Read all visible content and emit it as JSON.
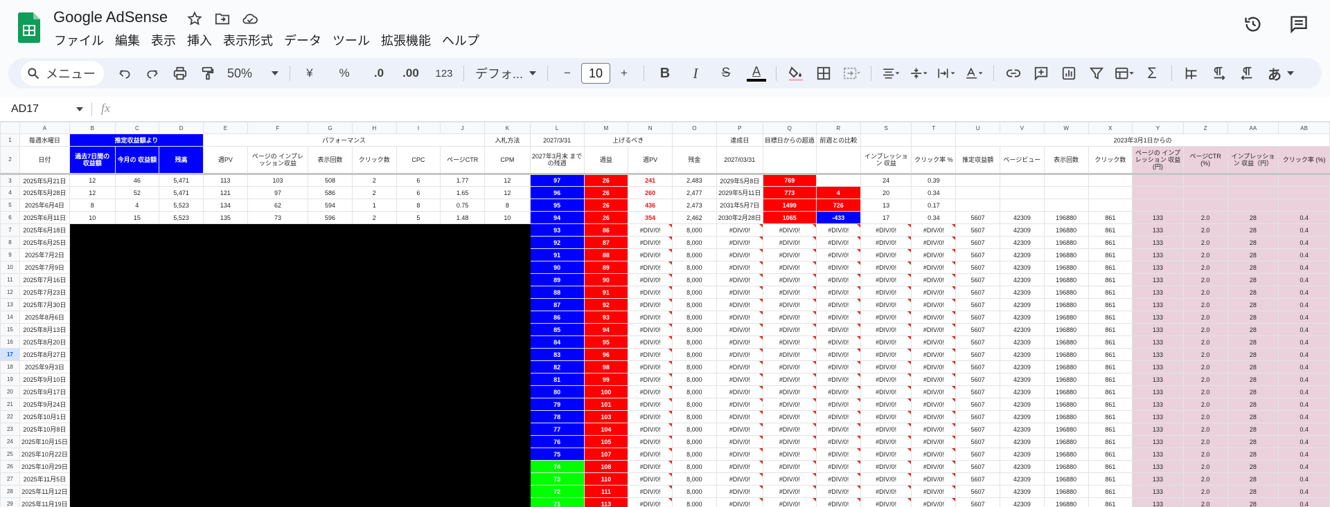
{
  "app": {
    "title": "Google AdSense",
    "menu": [
      "ファイル",
      "編集",
      "表示",
      "挿入",
      "表示形式",
      "データ",
      "ツール",
      "拡張機能",
      "ヘルプ"
    ]
  },
  "toolbar": {
    "search_label": "メニュー",
    "zoom": "50%",
    "currency": "¥",
    "percent": "%",
    "dec_decrease": ".0",
    "dec_increase": ".00",
    "number_format": "123",
    "font": "デフォ...",
    "font_size": "10",
    "minus": "−",
    "plus": "+",
    "bold": "B",
    "italic": "I",
    "strike": "S",
    "text_color": "A",
    "input_tools": "あ"
  },
  "formula_bar": {
    "name_box": "AD17",
    "fx": "fx"
  },
  "colors": {
    "blue": "#0000ff",
    "red": "#ff0000",
    "green": "#00ff00",
    "pink": "#ead1dc",
    "black": "#000000"
  },
  "grid": {
    "columns": [
      "A",
      "B",
      "C",
      "D",
      "E",
      "F",
      "G",
      "H",
      "I",
      "J",
      "K",
      "L",
      "M",
      "N",
      "O",
      "P",
      "Q",
      "R",
      "S",
      "T",
      "U",
      "V",
      "W",
      "X",
      "Y",
      "Z",
      "AA",
      "AB"
    ],
    "header_row1": {
      "A": "毎週水曜日",
      "BD": "推定収益額より",
      "EJ": "パフォーマンス",
      "K": "入札方法",
      "L": "2027/3/31",
      "MN": "上げるべき",
      "P": "達成日",
      "Q": "目標日からの超過",
      "R": "前週との比較",
      "UAB": "2023年3月1日からの"
    },
    "header_row2": [
      "日付",
      "過去7日間の 収益額",
      "今月の 収益額",
      "残高",
      "週PV",
      "ページの インプレッション収益",
      "表示回数",
      "クリック数",
      "CPC",
      "ページCTR",
      "CPM",
      "2027年3月末 までの残週",
      "週益",
      "週PV",
      "残金",
      "2027/03/31",
      "",
      "",
      "インプレッション 収益",
      "クリック率 %",
      "推定収益額",
      "ページビュー",
      "表示回数",
      "クリック数",
      "ページの インプレッション 収益(円)",
      "ページCTR (%)",
      "インプレッション 収益（円）",
      "クリック率 (%)"
    ],
    "top_rows": [
      {
        "num": "3",
        "A": "2025年5月21日",
        "B": "12",
        "C": "46",
        "D": "5,471",
        "E": "113",
        "F": "103",
        "G": "508",
        "H": "2",
        "I": "6",
        "J": "1.77",
        "K": "12",
        "L": "97",
        "M": "26",
        "N": "241",
        "O": "2,483",
        "P": "2029年5月8日",
        "Q": "769",
        "R": "",
        "S": "24",
        "T": "0.39"
      },
      {
        "num": "4",
        "A": "2025年5月28日",
        "B": "12",
        "C": "52",
        "D": "5,471",
        "E": "121",
        "F": "97",
        "G": "586",
        "H": "2",
        "I": "6",
        "J": "1.65",
        "K": "12",
        "L": "96",
        "M": "26",
        "N": "260",
        "O": "2,477",
        "P": "2029年5月11日",
        "Q": "773",
        "R": "4",
        "S": "20",
        "T": "0.34"
      },
      {
        "num": "5",
        "A": "2025年6月4日",
        "B": "8",
        "C": "4",
        "D": "5,523",
        "E": "134",
        "F": "62",
        "G": "594",
        "H": "1",
        "I": "8",
        "J": "0.75",
        "K": "8",
        "L": "95",
        "M": "26",
        "N": "436",
        "O": "2,473",
        "P": "2031年5月7日",
        "Q": "1499",
        "R": "726",
        "S": "13",
        "T": "0.17"
      },
      {
        "num": "6",
        "A": "2025年6月11日",
        "B": "10",
        "C": "15",
        "D": "5,523",
        "E": "135",
        "F": "73",
        "G": "596",
        "H": "2",
        "I": "5",
        "J": "1.48",
        "K": "10",
        "L": "94",
        "M": "26",
        "N": "354",
        "O": "2,462",
        "P": "2030年2月28日",
        "Q": "1065",
        "R": "-433",
        "S": "17",
        "T": "0.34",
        "U": "5607",
        "V": "42309",
        "W": "196880",
        "X": "861",
        "Y": "133",
        "Z": "2.0",
        "AA": "28",
        "AB": "0.4"
      }
    ],
    "lower_rows": [
      {
        "num": "7",
        "A": "2025年6月18日",
        "L": "93",
        "M": "86"
      },
      {
        "num": "8",
        "A": "2025年6月25日",
        "L": "92",
        "M": "87"
      },
      {
        "num": "9",
        "A": "2025年7月2日",
        "L": "91",
        "M": "88"
      },
      {
        "num": "10",
        "A": "2025年7月9日",
        "L": "90",
        "M": "89"
      },
      {
        "num": "11",
        "A": "2025年7月16日",
        "L": "89",
        "M": "90"
      },
      {
        "num": "12",
        "A": "2025年7月23日",
        "L": "88",
        "M": "91"
      },
      {
        "num": "13",
        "A": "2025年7月30日",
        "L": "87",
        "M": "92"
      },
      {
        "num": "14",
        "A": "2025年8月6日",
        "L": "86",
        "M": "93"
      },
      {
        "num": "15",
        "A": "2025年8月13日",
        "L": "85",
        "M": "94"
      },
      {
        "num": "16",
        "A": "2025年8月20日",
        "L": "84",
        "M": "95"
      },
      {
        "num": "17",
        "A": "2025年8月27日",
        "L": "83",
        "M": "96"
      },
      {
        "num": "18",
        "A": "2025年9月3日",
        "L": "82",
        "M": "98"
      },
      {
        "num": "19",
        "A": "2025年9月10日",
        "L": "81",
        "M": "99"
      },
      {
        "num": "20",
        "A": "2025年9月17日",
        "L": "80",
        "M": "100"
      },
      {
        "num": "21",
        "A": "2025年9月24日",
        "L": "79",
        "M": "101"
      },
      {
        "num": "22",
        "A": "2025年10月1日",
        "L": "78",
        "M": "103"
      },
      {
        "num": "23",
        "A": "2025年10月8日",
        "L": "77",
        "M": "104"
      },
      {
        "num": "24",
        "A": "2025年10月15日",
        "L": "76",
        "M": "105"
      },
      {
        "num": "25",
        "A": "2025年10月22日",
        "L": "75",
        "M": "107"
      },
      {
        "num": "26",
        "A": "2025年10月29日",
        "L": "74",
        "M": "108"
      },
      {
        "num": "27",
        "A": "2025年11月5日",
        "L": "73",
        "M": "110"
      },
      {
        "num": "28",
        "A": "2025年11月12日",
        "L": "72",
        "M": "111"
      },
      {
        "num": "29",
        "A": "2025年11月19日",
        "L": "71",
        "M": "113"
      }
    ],
    "repeat_values": {
      "N": "#DIV/0!",
      "O": "8,000",
      "P": "#DIV/0!",
      "Q": "#DIV/0!",
      "R": "#DIV/0!",
      "S": "#DIV/0!",
      "T": "#DIV/0!",
      "U": "5607",
      "V": "42309",
      "W": "196880",
      "X": "861",
      "Y": "133",
      "Z": "2.0",
      "AA": "28",
      "AB": "0.4"
    },
    "selected_row": "17"
  }
}
